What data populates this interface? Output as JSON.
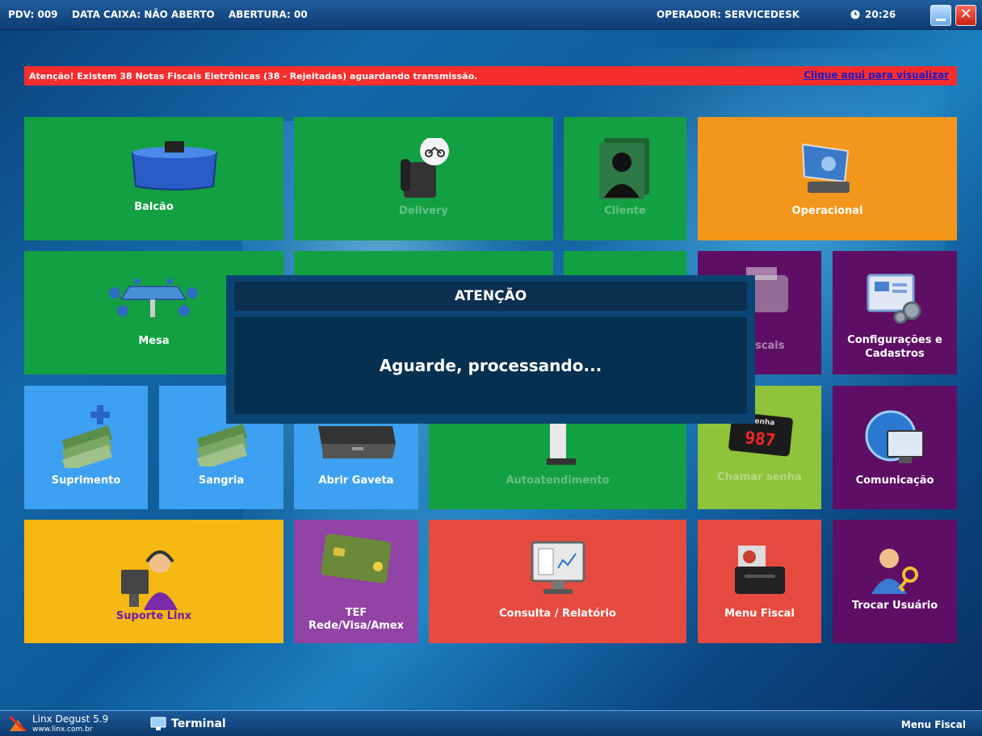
{
  "topbar": {
    "pdv": "PDV: 009",
    "data_caixa": "DATA CAIXA: NÃO ABERTO",
    "abertura": "ABERTURA: 00",
    "operador": "OPERADOR: SERVICEDESK",
    "clock": "20:26"
  },
  "alert": {
    "message": "Atenção! Existem 38 Notas Fiscais Eletrônicas (38 - Rejeitadas) aguardando transmissão.",
    "link": "Clique aqui para visualizar"
  },
  "tiles": {
    "balcao": "Balcão",
    "delivery": "Delivery",
    "cliente": "Cliente",
    "operacional": "Operacional",
    "mesa": "Mesa",
    "notas_fiscais": "s Fiscais",
    "configuracoes_1": "Configurações e",
    "configuracoes_2": "Cadastros",
    "suprimento": "Suprimento",
    "sangria": "Sangria",
    "abrir_gaveta": "Abrir Gaveta",
    "autoatendimento": "Autoatendimento",
    "chamar_senha": "Chamar senha",
    "senha_label": "Senha",
    "senha_num": "987",
    "comunicacao": "Comunicação",
    "suporte": "Suporte Linx",
    "tef_1": "TEF",
    "tef_2": "Rede/Visa/Amex",
    "consulta": "Consulta / Relatório",
    "menu_fiscal": "Menu Fiscal",
    "trocar_usuario": "Trocar Usuário"
  },
  "modal": {
    "title": "ATENÇÃO",
    "message": "Aguarde, processando..."
  },
  "bottombar": {
    "brand": "Linx Degust 5.9",
    "url": "www.linx.com.br",
    "terminal": "Terminal",
    "menu_fiscal": "Menu Fiscal"
  },
  "colors": {
    "green": "#13a043",
    "orange": "#f3961c",
    "purple": "#5e0e64",
    "blue": "#3ea0f0",
    "lime": "#8fc33a",
    "yellow": "#f5b813",
    "violet": "#9143a6",
    "red": "#e74a3e",
    "alert": "#f52d2d"
  }
}
